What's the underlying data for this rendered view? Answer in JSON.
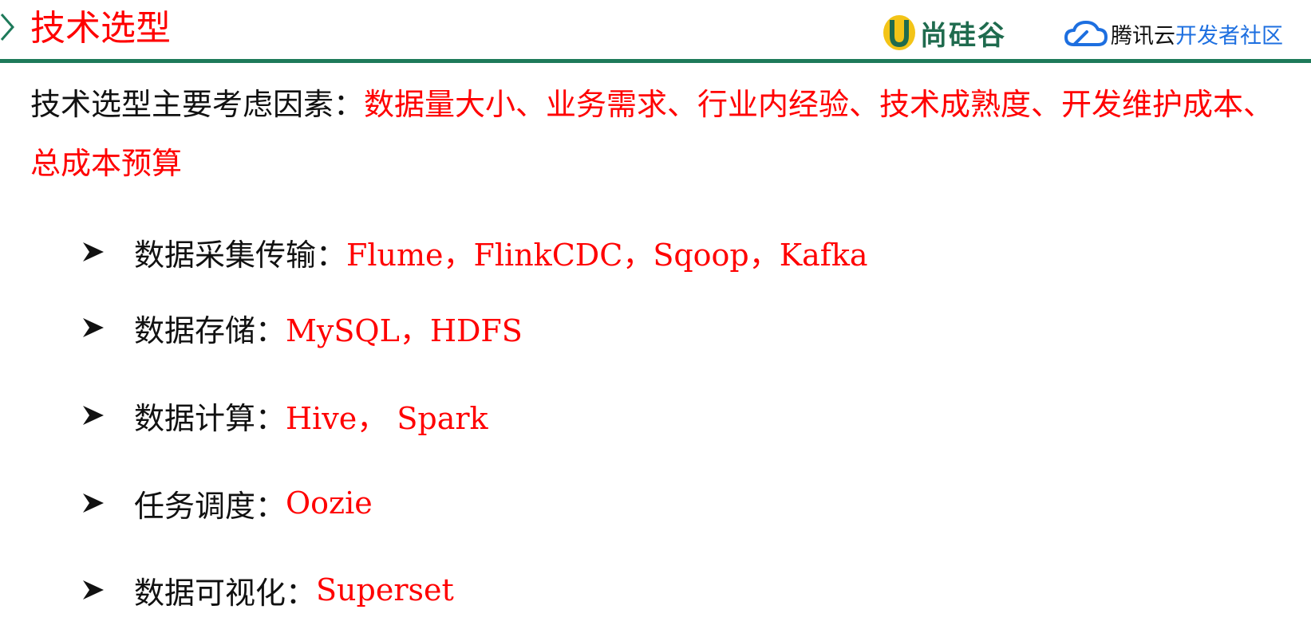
{
  "header": {
    "title": "技术选型",
    "logo_left_text": "尚硅谷",
    "logo_right_text_a": "腾讯云",
    "logo_right_text_b": "开发者社区",
    "accent_color": "#1e7a5a",
    "title_color": "#ff0000"
  },
  "intro": {
    "lead": "技术选型主要考虑因素：",
    "factors": "数据量大小、业务需求、行业内经验、技术成熟度、开发维护成本、总成本预算"
  },
  "items": [
    {
      "label": "数据采集传输：",
      "value": "Flume，FlinkCDC，Sqoop，Kafka"
    },
    {
      "label": "数据存储：",
      "value": "MySQL，HDFS"
    },
    {
      "label": "数据计算：",
      "value": "Hive， Spark"
    },
    {
      "label": "任务调度：",
      "value": "Oozie"
    },
    {
      "label": "数据可视化：",
      "value": "Superset"
    }
  ],
  "icons": {
    "bullet": "arrowhead-bullet-icon",
    "header_marker": "chevron-right-icon",
    "logo_left": "atguigu-u-logo-icon",
    "logo_right": "tencent-cloud-logo-icon"
  }
}
